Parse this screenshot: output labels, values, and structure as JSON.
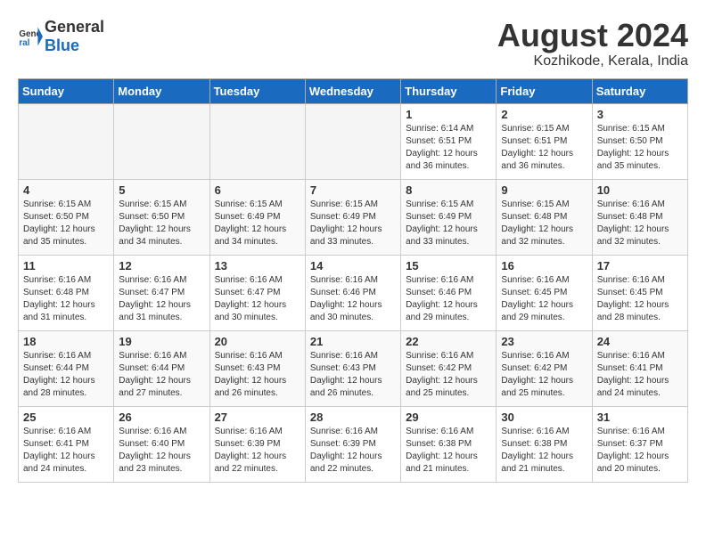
{
  "header": {
    "logo_general": "General",
    "logo_blue": "Blue",
    "month_title": "August 2024",
    "location": "Kozhikode, Kerala, India"
  },
  "days_of_week": [
    "Sunday",
    "Monday",
    "Tuesday",
    "Wednesday",
    "Thursday",
    "Friday",
    "Saturday"
  ],
  "weeks": [
    [
      {
        "day": "",
        "info": ""
      },
      {
        "day": "",
        "info": ""
      },
      {
        "day": "",
        "info": ""
      },
      {
        "day": "",
        "info": ""
      },
      {
        "day": "1",
        "info": "Sunrise: 6:14 AM\nSunset: 6:51 PM\nDaylight: 12 hours\nand 36 minutes."
      },
      {
        "day": "2",
        "info": "Sunrise: 6:15 AM\nSunset: 6:51 PM\nDaylight: 12 hours\nand 36 minutes."
      },
      {
        "day": "3",
        "info": "Sunrise: 6:15 AM\nSunset: 6:50 PM\nDaylight: 12 hours\nand 35 minutes."
      }
    ],
    [
      {
        "day": "4",
        "info": "Sunrise: 6:15 AM\nSunset: 6:50 PM\nDaylight: 12 hours\nand 35 minutes."
      },
      {
        "day": "5",
        "info": "Sunrise: 6:15 AM\nSunset: 6:50 PM\nDaylight: 12 hours\nand 34 minutes."
      },
      {
        "day": "6",
        "info": "Sunrise: 6:15 AM\nSunset: 6:49 PM\nDaylight: 12 hours\nand 34 minutes."
      },
      {
        "day": "7",
        "info": "Sunrise: 6:15 AM\nSunset: 6:49 PM\nDaylight: 12 hours\nand 33 minutes."
      },
      {
        "day": "8",
        "info": "Sunrise: 6:15 AM\nSunset: 6:49 PM\nDaylight: 12 hours\nand 33 minutes."
      },
      {
        "day": "9",
        "info": "Sunrise: 6:15 AM\nSunset: 6:48 PM\nDaylight: 12 hours\nand 32 minutes."
      },
      {
        "day": "10",
        "info": "Sunrise: 6:16 AM\nSunset: 6:48 PM\nDaylight: 12 hours\nand 32 minutes."
      }
    ],
    [
      {
        "day": "11",
        "info": "Sunrise: 6:16 AM\nSunset: 6:48 PM\nDaylight: 12 hours\nand 31 minutes."
      },
      {
        "day": "12",
        "info": "Sunrise: 6:16 AM\nSunset: 6:47 PM\nDaylight: 12 hours\nand 31 minutes."
      },
      {
        "day": "13",
        "info": "Sunrise: 6:16 AM\nSunset: 6:47 PM\nDaylight: 12 hours\nand 30 minutes."
      },
      {
        "day": "14",
        "info": "Sunrise: 6:16 AM\nSunset: 6:46 PM\nDaylight: 12 hours\nand 30 minutes."
      },
      {
        "day": "15",
        "info": "Sunrise: 6:16 AM\nSunset: 6:46 PM\nDaylight: 12 hours\nand 29 minutes."
      },
      {
        "day": "16",
        "info": "Sunrise: 6:16 AM\nSunset: 6:45 PM\nDaylight: 12 hours\nand 29 minutes."
      },
      {
        "day": "17",
        "info": "Sunrise: 6:16 AM\nSunset: 6:45 PM\nDaylight: 12 hours\nand 28 minutes."
      }
    ],
    [
      {
        "day": "18",
        "info": "Sunrise: 6:16 AM\nSunset: 6:44 PM\nDaylight: 12 hours\nand 28 minutes."
      },
      {
        "day": "19",
        "info": "Sunrise: 6:16 AM\nSunset: 6:44 PM\nDaylight: 12 hours\nand 27 minutes."
      },
      {
        "day": "20",
        "info": "Sunrise: 6:16 AM\nSunset: 6:43 PM\nDaylight: 12 hours\nand 26 minutes."
      },
      {
        "day": "21",
        "info": "Sunrise: 6:16 AM\nSunset: 6:43 PM\nDaylight: 12 hours\nand 26 minutes."
      },
      {
        "day": "22",
        "info": "Sunrise: 6:16 AM\nSunset: 6:42 PM\nDaylight: 12 hours\nand 25 minutes."
      },
      {
        "day": "23",
        "info": "Sunrise: 6:16 AM\nSunset: 6:42 PM\nDaylight: 12 hours\nand 25 minutes."
      },
      {
        "day": "24",
        "info": "Sunrise: 6:16 AM\nSunset: 6:41 PM\nDaylight: 12 hours\nand 24 minutes."
      }
    ],
    [
      {
        "day": "25",
        "info": "Sunrise: 6:16 AM\nSunset: 6:41 PM\nDaylight: 12 hours\nand 24 minutes."
      },
      {
        "day": "26",
        "info": "Sunrise: 6:16 AM\nSunset: 6:40 PM\nDaylight: 12 hours\nand 23 minutes."
      },
      {
        "day": "27",
        "info": "Sunrise: 6:16 AM\nSunset: 6:39 PM\nDaylight: 12 hours\nand 22 minutes."
      },
      {
        "day": "28",
        "info": "Sunrise: 6:16 AM\nSunset: 6:39 PM\nDaylight: 12 hours\nand 22 minutes."
      },
      {
        "day": "29",
        "info": "Sunrise: 6:16 AM\nSunset: 6:38 PM\nDaylight: 12 hours\nand 21 minutes."
      },
      {
        "day": "30",
        "info": "Sunrise: 6:16 AM\nSunset: 6:38 PM\nDaylight: 12 hours\nand 21 minutes."
      },
      {
        "day": "31",
        "info": "Sunrise: 6:16 AM\nSunset: 6:37 PM\nDaylight: 12 hours\nand 20 minutes."
      }
    ]
  ]
}
